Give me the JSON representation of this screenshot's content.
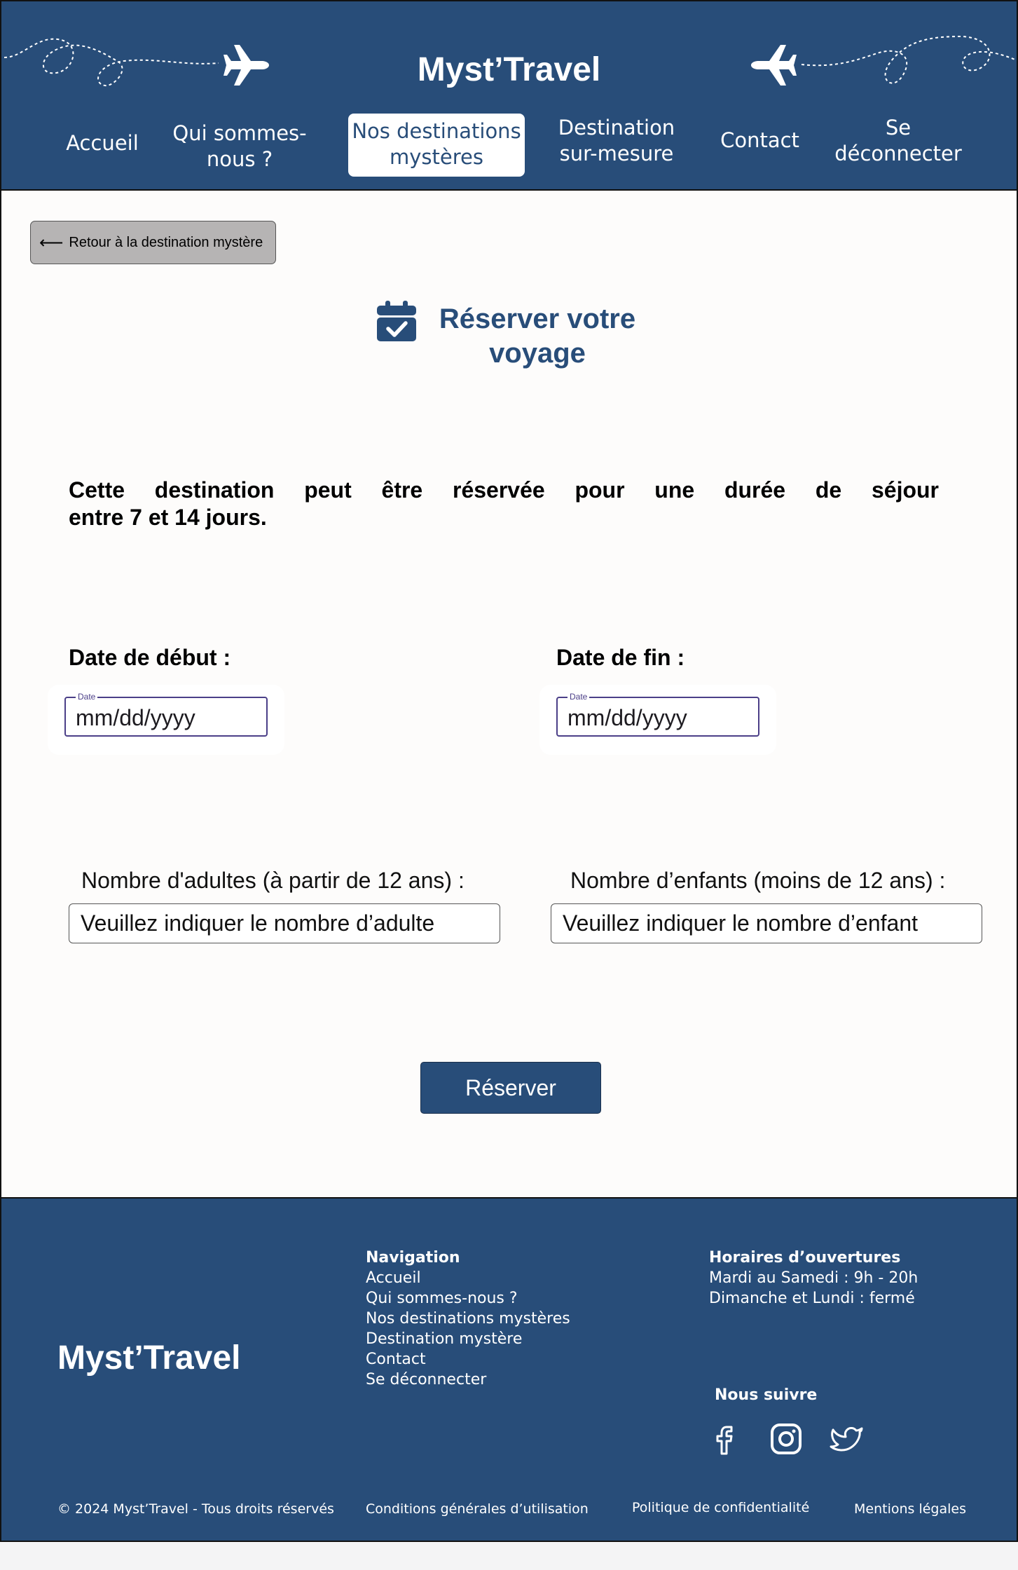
{
  "header": {
    "site_title": "Myst’Travel",
    "nav": [
      {
        "label": "Accueil"
      },
      {
        "label": "Qui sommes-nous ?"
      },
      {
        "label": "Nos destinations mystères",
        "active": true
      },
      {
        "label": "Destination sur-mesure"
      },
      {
        "label": "Contact"
      },
      {
        "label": "Se déconnecter"
      }
    ]
  },
  "main": {
    "back_label": "Retour à la destination mystère",
    "title": "Réserver votre voyage",
    "duration_line1": "Cette destination peut être réservée pour une durée de séjour",
    "duration_line2": "entre 7 et 14 jours.",
    "start_date": {
      "label": "Date de début :",
      "legend": "Date",
      "value": "mm/dd/yyyy"
    },
    "end_date": {
      "label": "Date de fin :",
      "legend": "Date",
      "value": "mm/dd/yyyy"
    },
    "adults": {
      "label": "Nombre d'adultes (à partir de 12 ans) :",
      "placeholder": "Veuillez indiquer le nombre d’adulte"
    },
    "children": {
      "label": "Nombre d’enfants (moins de 12 ans) :",
      "placeholder": "Veuillez indiquer le nombre d’enfant"
    },
    "submit_label": "Réserver"
  },
  "footer": {
    "logo": "Myst’Travel",
    "navigation": {
      "heading": "Navigation",
      "links": [
        "Accueil",
        "Qui sommes-nous ?",
        "Nos destinations mystères",
        "Destination mystère",
        "Contact",
        "Se déconnecter"
      ]
    },
    "hours": {
      "heading": "Horaires d’ouvertures",
      "lines": [
        "Mardi au Samedi : 9h - 20h",
        "Dimanche et Lundi : fermé"
      ]
    },
    "follow_heading": "Nous suivre",
    "socials": [
      "facebook-icon",
      "instagram-icon",
      "twitter-icon"
    ],
    "copyright": "© 2024 Myst’Travel - Tous droits réservés",
    "terms": "Conditions générales d’utilisation",
    "privacy": "Politique de confidentialité",
    "legal": "Mentions légales"
  },
  "colors": {
    "brand": "#284d79",
    "back_button": "#b6b4b4",
    "date_field_border": "#4b3f88",
    "page_background": "#fdfcfb"
  }
}
